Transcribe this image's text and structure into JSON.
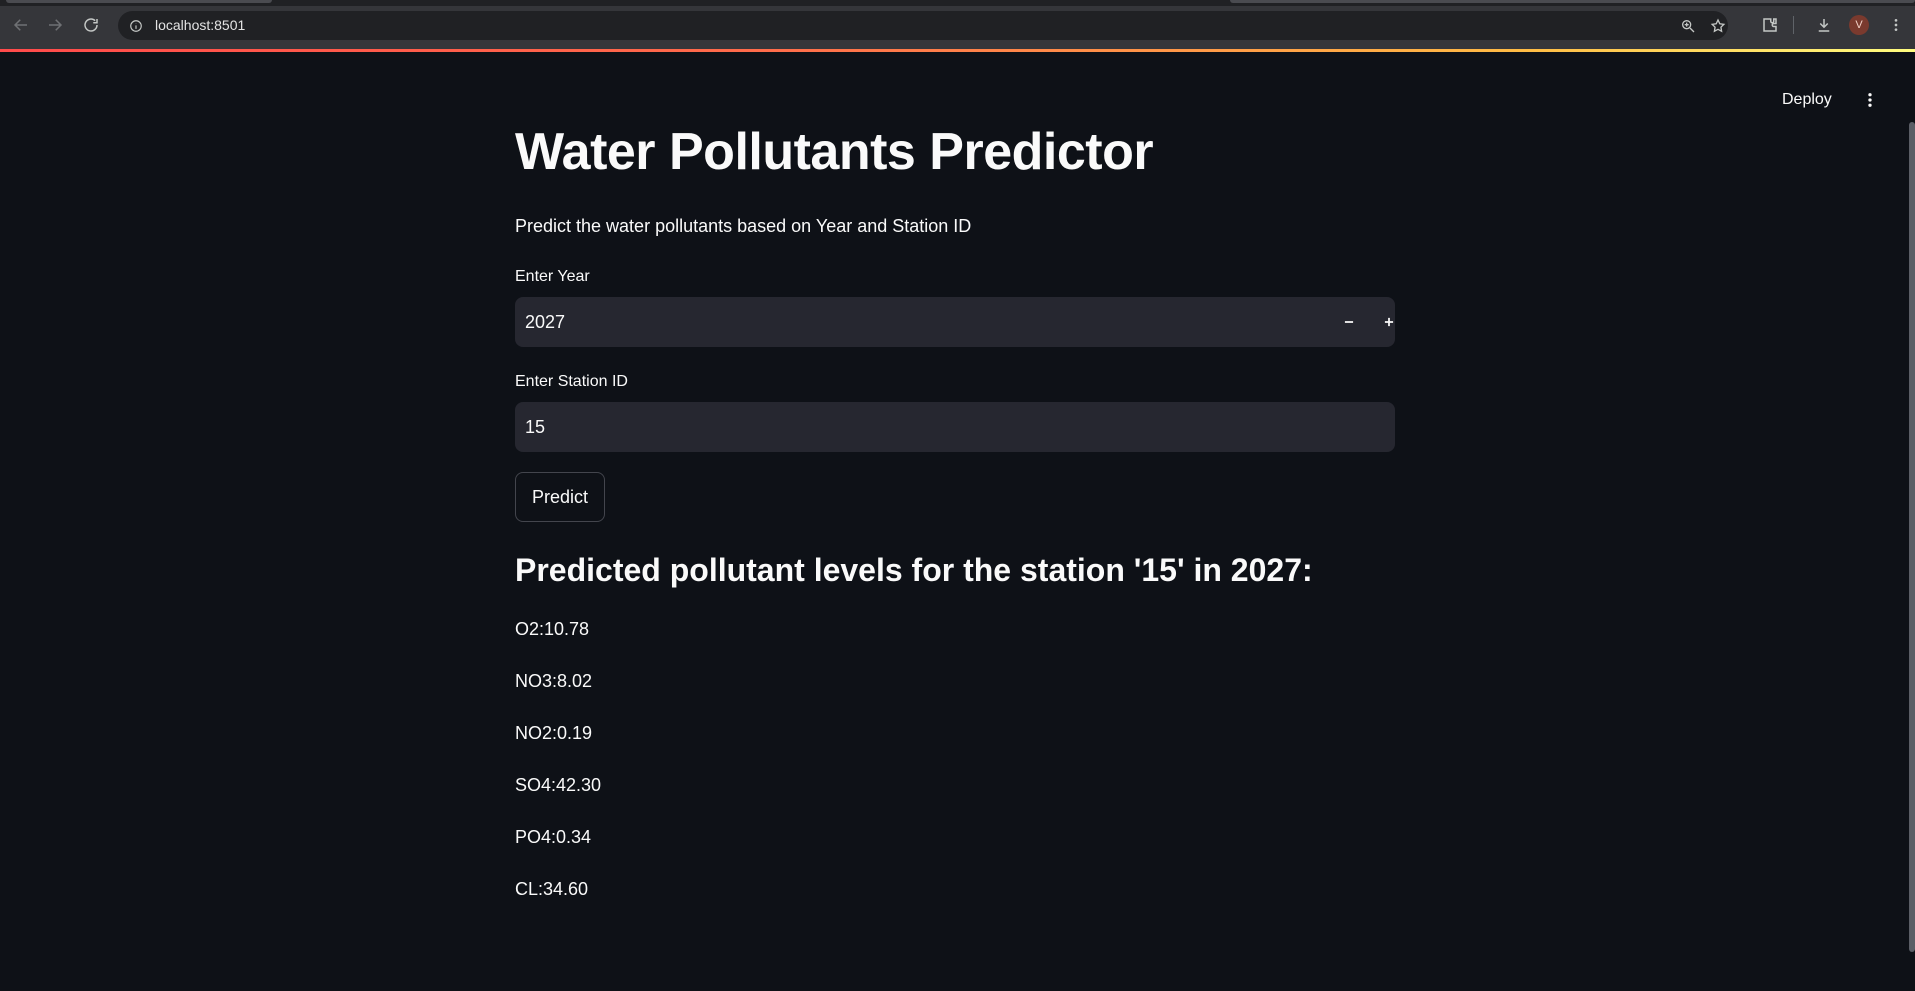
{
  "browser": {
    "url": "localhost:8501",
    "profile_initial": "V"
  },
  "header": {
    "deploy_label": "Deploy"
  },
  "main": {
    "title": "Water Pollutants Predictor",
    "subtitle": "Predict the water pollutants based on Year and Station ID",
    "year_field": {
      "label": "Enter Year",
      "value": "2027",
      "decrement": "−",
      "increment": "+"
    },
    "station_field": {
      "label": "Enter Station ID",
      "value": "15"
    },
    "predict_label": "Predict",
    "result_heading": "Predicted pollutant levels for the station '15' in 2027:",
    "results": [
      "O2:10.78",
      "NO3:8.02",
      "NO2:0.19",
      "SO4:42.30",
      "PO4:0.34",
      "CL:34.60"
    ]
  },
  "theme": {
    "background": "#0e1117",
    "input_background": "#262730",
    "accent_gradient_start": "#ff4b4b",
    "accent_gradient_end": "#fffd80"
  }
}
